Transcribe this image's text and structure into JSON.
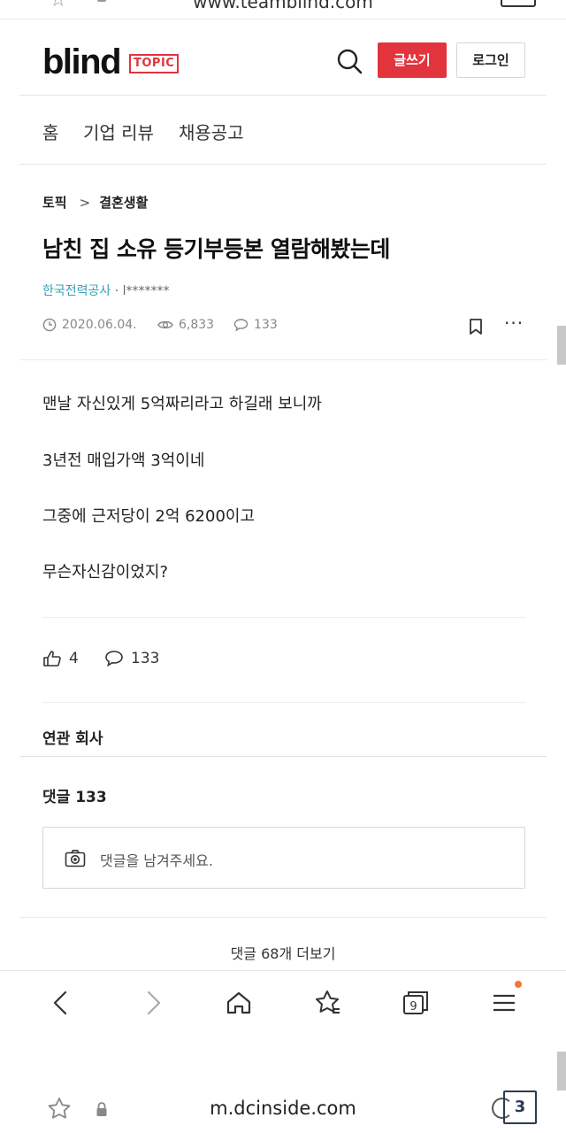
{
  "top_browser": {
    "url": "www.teamblind.com"
  },
  "header": {
    "logo": "blind",
    "badge": "TOPIC",
    "write_label": "글쓰기",
    "login_label": "로그인",
    "brand_color": "#e2343d"
  },
  "nav": {
    "items": [
      "홈",
      "기업 리뷰",
      "채용공고"
    ]
  },
  "post": {
    "breadcrumb": [
      "토픽",
      "결혼생활"
    ],
    "title": "남친 집 소유 등기부등본 열람해봤는데",
    "company": "한국전력공사",
    "author_sep": " · ",
    "author": "l*******",
    "date": "2020.06.04.",
    "views": "6,833",
    "comments": "133",
    "body": [
      "맨날 자신있게 5억짜리라고 하길래 보니까",
      "3년전 매입가액 3억이네",
      "그중에 근저당이 2억 6200이고",
      "무슨자신감이었지?"
    ],
    "likes": "4",
    "comment_count": "133"
  },
  "related": {
    "title": "연관 회사"
  },
  "comments_section": {
    "title": "댓글 133",
    "placeholder": "댓글을 남겨주세요.",
    "more_label": "댓글 68개 더보기"
  },
  "browser_toolbar": {
    "icons": [
      "back-icon",
      "forward-icon",
      "home-icon",
      "favorites-icon",
      "tabs-icon",
      "menu-icon"
    ],
    "tab_count": "9",
    "notification_color": "#f0763a"
  },
  "bottom_browser": {
    "url": "m.dcinside.com",
    "tab_count": "3"
  }
}
